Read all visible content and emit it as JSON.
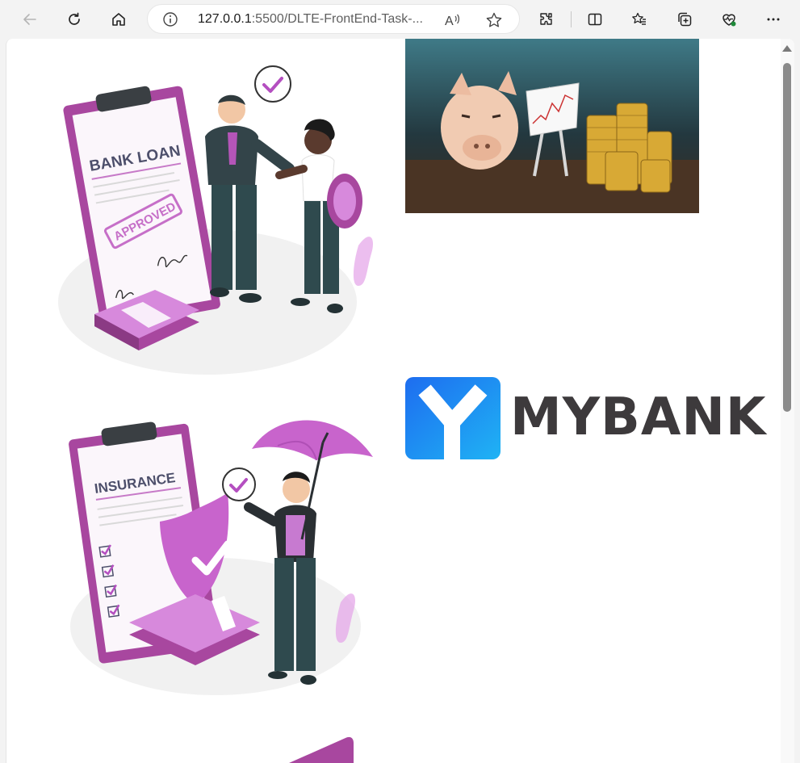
{
  "browser": {
    "url_host": "127.0.0.1",
    "url_rest": ":5500/DLTE-FrontEnd-Task-...",
    "icons": [
      "back-icon",
      "refresh-icon",
      "home-icon",
      "info-icon",
      "read-aloud-icon",
      "favorite-star-icon",
      "extensions-icon",
      "split-screen-icon",
      "favorites-icon",
      "collections-icon",
      "browser-essentials-icon",
      "more-icon"
    ]
  },
  "page": {
    "bank_loan_card": {
      "title": "BANK LOAN",
      "stamp": "APPROVED"
    },
    "insurance_card": {
      "title": "INSURANCE"
    },
    "logo": {
      "text": "MYBANK"
    }
  },
  "colors": {
    "accent_purple": "#b44fc0",
    "light_purple": "#e4a2e8",
    "dark_teal": "#2f4a4e",
    "logo_blue": "#1e7cf2",
    "logo_text": "#3d3a3c"
  }
}
